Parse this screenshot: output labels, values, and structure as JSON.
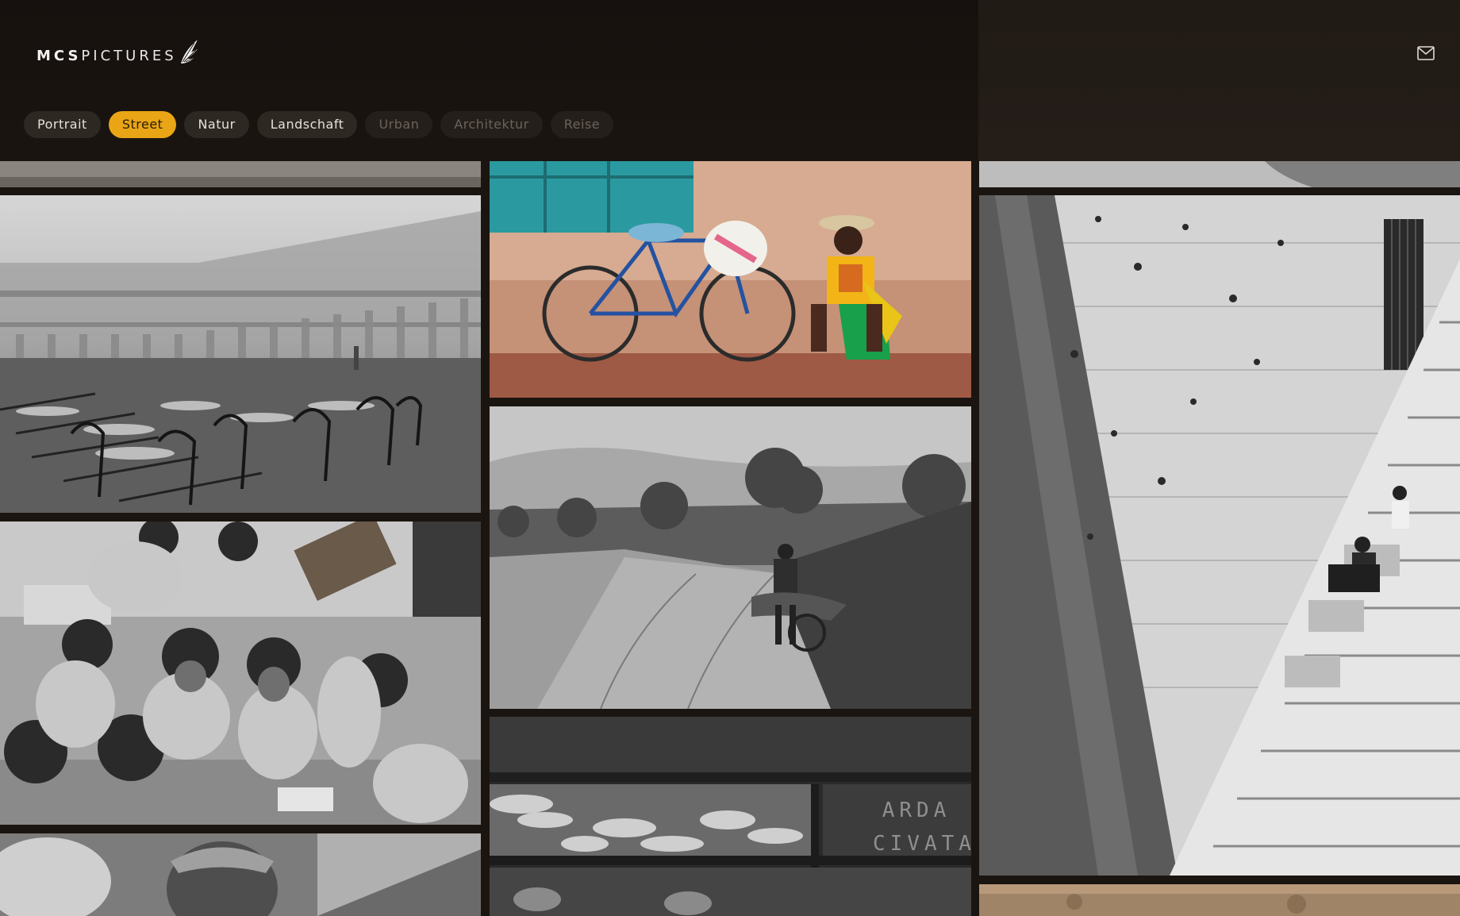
{
  "brand": {
    "bold": "MCS",
    "light": "PICTURES"
  },
  "header": {
    "contact_icon": "mail-icon"
  },
  "filters": [
    {
      "label": "Portrait",
      "state": "normal"
    },
    {
      "label": "Street",
      "state": "active"
    },
    {
      "label": "Natur",
      "state": "normal"
    },
    {
      "label": "Landschaft",
      "state": "normal"
    },
    {
      "label": "Urban",
      "state": "dim"
    },
    {
      "label": "Architektur",
      "state": "dim"
    },
    {
      "label": "Reise",
      "state": "dim"
    }
  ],
  "photos": {
    "shop_sign_line1": "ARDA",
    "shop_sign_line2": "CIVATA"
  },
  "colors": {
    "accent": "#e9a516",
    "background": "#1b1511",
    "chip_bg": "#2e2823"
  }
}
